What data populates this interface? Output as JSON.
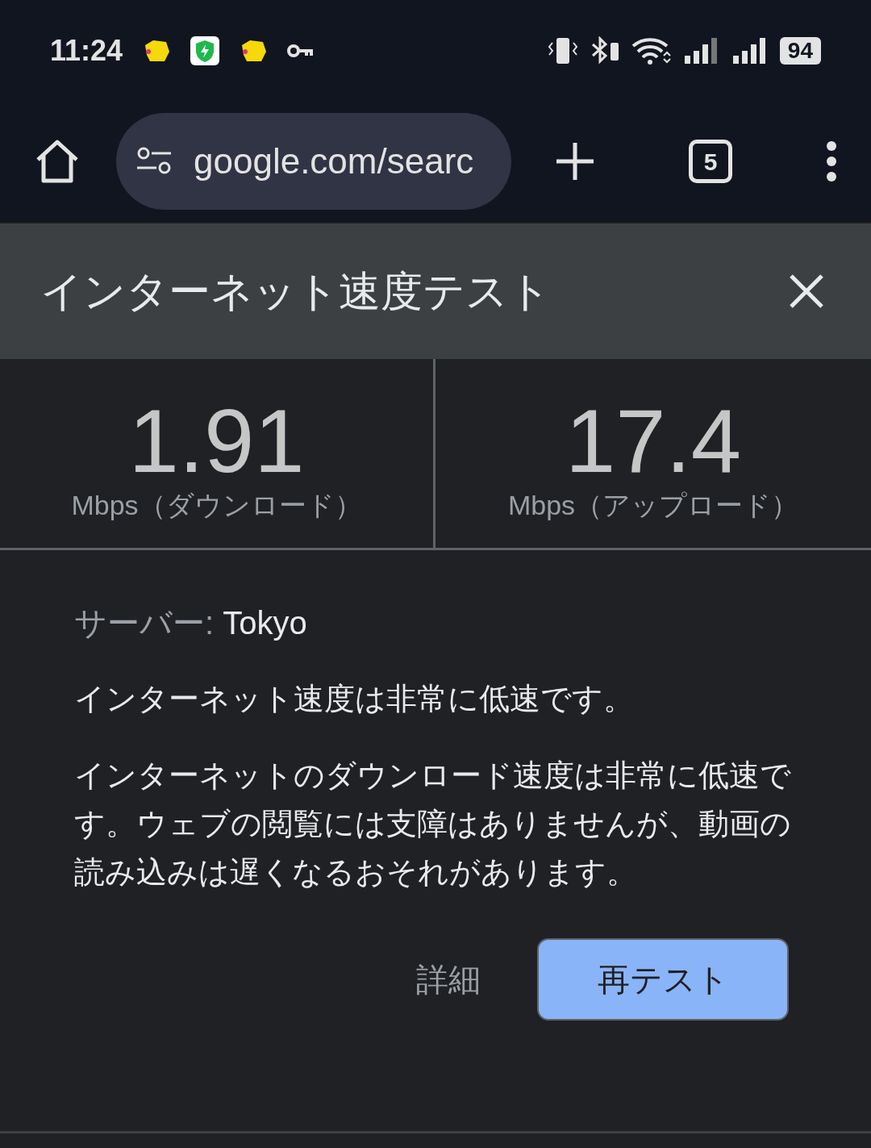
{
  "status_bar": {
    "time": "11:24",
    "battery": "94"
  },
  "browser": {
    "url": "google.com/searc",
    "tab_count": "5"
  },
  "card": {
    "title": "インターネット速度テスト",
    "results": [
      {
        "value": "1.91",
        "label": "Mbps（ダウンロード）"
      },
      {
        "value": "17.4",
        "label": "Mbps（アップロード）"
      }
    ],
    "server_label": "サーバー:",
    "server": "Tokyo",
    "summary": "インターネット速度は非常に低速です。",
    "description": "インターネットのダウンロード速度は非常に低速です。ウェブの閲覧には支障はありませんが、動画の読み込みは遅くなるおそれがあります。",
    "buttons": [
      {
        "kind": "text",
        "label": "詳細"
      },
      {
        "kind": "filled",
        "label": "再テスト"
      }
    ]
  }
}
